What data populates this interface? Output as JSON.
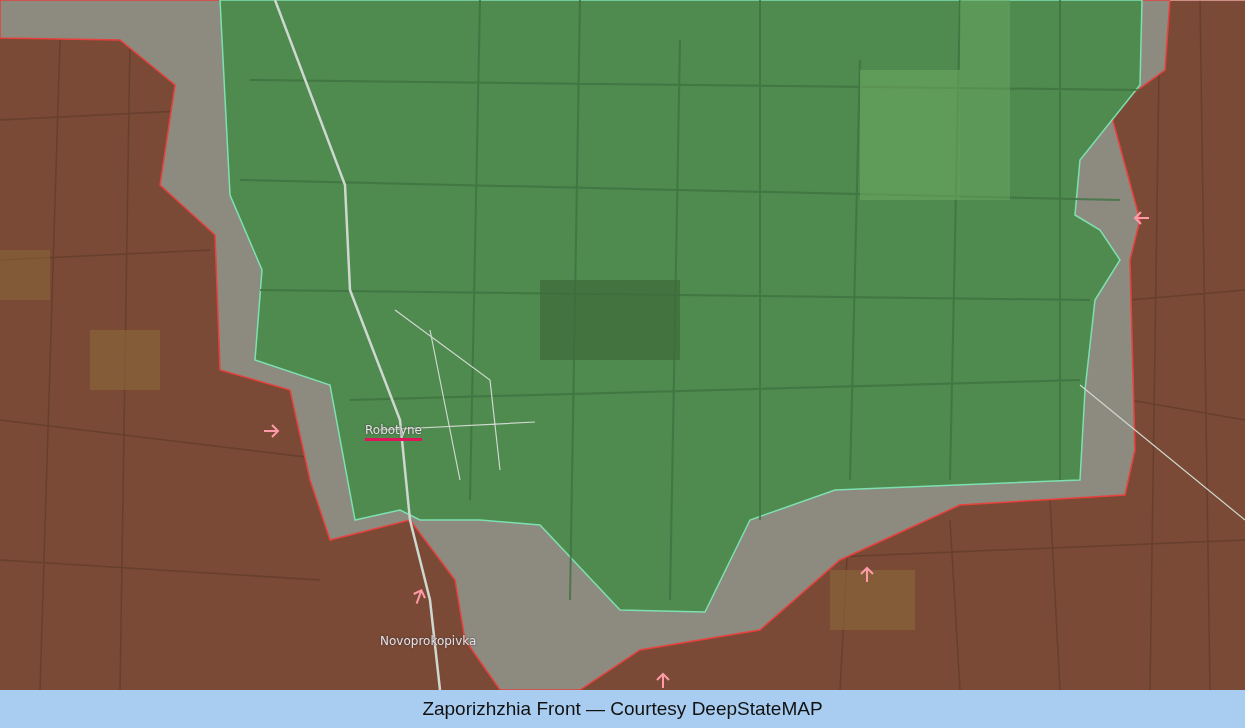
{
  "map": {
    "places": [
      {
        "name": "Robotyne",
        "marked": true
      },
      {
        "name": "Novoprokopivka",
        "marked": false
      }
    ]
  },
  "caption": "Zaporizhzhia Front — Courtesy DeepStateMAP"
}
